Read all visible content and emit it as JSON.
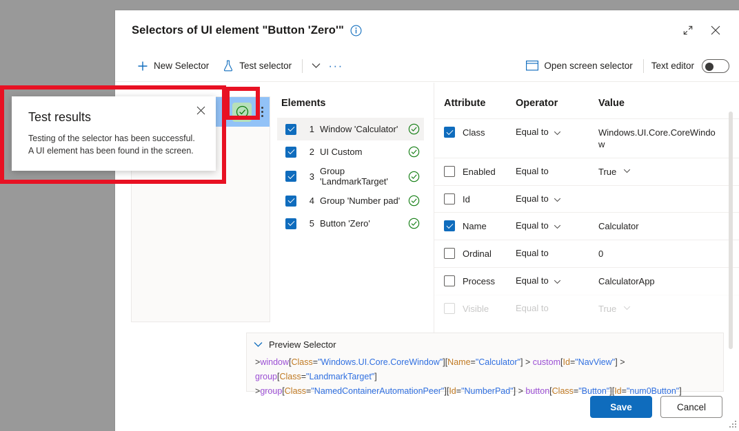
{
  "dialog": {
    "title": "Selectors of UI element \"Button 'Zero'\"",
    "info_icon": "info-icon",
    "expand_icon": "expand-icon",
    "close_icon": "close-icon"
  },
  "commandbar": {
    "new_selector": "New Selector",
    "test_selector": "Test selector",
    "chevron": "chevron-down-icon",
    "overflow": "···",
    "open_screen_selector": "Open screen selector",
    "text_editor_label": "Text editor",
    "text_editor_on": false
  },
  "selector_card": {
    "status_icon": "check-circle-icon",
    "more_icon": "more-vertical-icon"
  },
  "elements": {
    "title": "Elements",
    "items": [
      {
        "index": "1",
        "label": "Window 'Calculator'",
        "checked": true,
        "status": "ok",
        "selected": true
      },
      {
        "index": "2",
        "label": "UI Custom",
        "checked": true,
        "status": "ok",
        "selected": false
      },
      {
        "index": "3",
        "label": "Group 'LandmarkTarget'",
        "checked": true,
        "status": "ok",
        "selected": false
      },
      {
        "index": "4",
        "label": "Group 'Number pad'",
        "checked": true,
        "status": "ok",
        "selected": false
      },
      {
        "index": "5",
        "label": "Button 'Zero'",
        "checked": true,
        "status": "ok",
        "selected": false
      }
    ]
  },
  "attributes": {
    "headers": {
      "attribute": "Attribute",
      "operator": "Operator",
      "value": "Value"
    },
    "rows": [
      {
        "name": "Class",
        "checked": true,
        "operator": "Equal to",
        "op_dropdown": true,
        "value": "Windows.UI.Core.CoreWindow",
        "val_dropdown": false
      },
      {
        "name": "Enabled",
        "checked": false,
        "operator": "Equal to",
        "op_dropdown": false,
        "value": "True",
        "val_dropdown": true
      },
      {
        "name": "Id",
        "checked": false,
        "operator": "Equal to",
        "op_dropdown": true,
        "value": "",
        "val_dropdown": false
      },
      {
        "name": "Name",
        "checked": true,
        "operator": "Equal to",
        "op_dropdown": true,
        "value": "Calculator",
        "val_dropdown": false
      },
      {
        "name": "Ordinal",
        "checked": false,
        "operator": "Equal to",
        "op_dropdown": false,
        "value": "0",
        "val_dropdown": false
      },
      {
        "name": "Process",
        "checked": false,
        "operator": "Equal to",
        "op_dropdown": true,
        "value": "CalculatorApp",
        "val_dropdown": false
      },
      {
        "name": "Visible",
        "checked": false,
        "operator": "Equal to",
        "op_dropdown": false,
        "value": "True",
        "val_dropdown": true,
        "clipped": true
      }
    ]
  },
  "preview": {
    "label": "Preview Selector",
    "expanded": true,
    "tokens": [
      {
        "t": "arrow",
        "s": ">"
      },
      {
        "t": "el",
        "s": "window"
      },
      {
        "t": "punct",
        "s": "["
      },
      {
        "t": "attr",
        "s": "Class"
      },
      {
        "t": "punct",
        "s": "="
      },
      {
        "t": "val",
        "s": "\"Windows.UI.Core.CoreWindow\""
      },
      {
        "t": "punct",
        "s": "]["
      },
      {
        "t": "attr",
        "s": "Name"
      },
      {
        "t": "punct",
        "s": "="
      },
      {
        "t": "val",
        "s": "\"Calculator\""
      },
      {
        "t": "punct",
        "s": "]"
      },
      {
        "t": "arrow",
        "s": " > "
      },
      {
        "t": "el",
        "s": "custom"
      },
      {
        "t": "punct",
        "s": "["
      },
      {
        "t": "attr",
        "s": "Id"
      },
      {
        "t": "punct",
        "s": "="
      },
      {
        "t": "val",
        "s": "\"NavView\""
      },
      {
        "t": "punct",
        "s": "]"
      },
      {
        "t": "arrow",
        "s": " > "
      },
      {
        "t": "el",
        "s": "group"
      },
      {
        "t": "punct",
        "s": "["
      },
      {
        "t": "attr",
        "s": "Class"
      },
      {
        "t": "punct",
        "s": "="
      },
      {
        "t": "val",
        "s": "\"LandmarkTarget\""
      },
      {
        "t": "punct",
        "s": "]"
      },
      {
        "t": "br",
        "s": ""
      },
      {
        "t": "arrow",
        "s": ">"
      },
      {
        "t": "el",
        "s": "group"
      },
      {
        "t": "punct",
        "s": "["
      },
      {
        "t": "attr",
        "s": "Class"
      },
      {
        "t": "punct",
        "s": "="
      },
      {
        "t": "val",
        "s": "\"NamedContainerAutomationPeer\""
      },
      {
        "t": "punct",
        "s": "]["
      },
      {
        "t": "attr",
        "s": "Id"
      },
      {
        "t": "punct",
        "s": "="
      },
      {
        "t": "val",
        "s": "\"NumberPad\""
      },
      {
        "t": "punct",
        "s": "]"
      },
      {
        "t": "arrow",
        "s": " > "
      },
      {
        "t": "el",
        "s": "button"
      },
      {
        "t": "punct",
        "s": "["
      },
      {
        "t": "attr",
        "s": "Class"
      },
      {
        "t": "punct",
        "s": "="
      },
      {
        "t": "val",
        "s": "\"Button\""
      },
      {
        "t": "punct",
        "s": "]["
      },
      {
        "t": "attr",
        "s": "Id"
      },
      {
        "t": "punct",
        "s": "="
      },
      {
        "t": "val",
        "s": "\"num0Button\""
      },
      {
        "t": "punct",
        "s": "]"
      }
    ]
  },
  "footer": {
    "save": "Save",
    "cancel": "Cancel"
  },
  "callout": {
    "title": "Test results",
    "message": "Testing of the selector has been successful. A UI element has been found in the screen.",
    "close_icon": "close-icon"
  },
  "colors": {
    "accent": "#0f6cbd",
    "success": "#107c10",
    "annotation": "#e81123",
    "highlight": "#92c2f7",
    "backdrop": "#999999"
  }
}
